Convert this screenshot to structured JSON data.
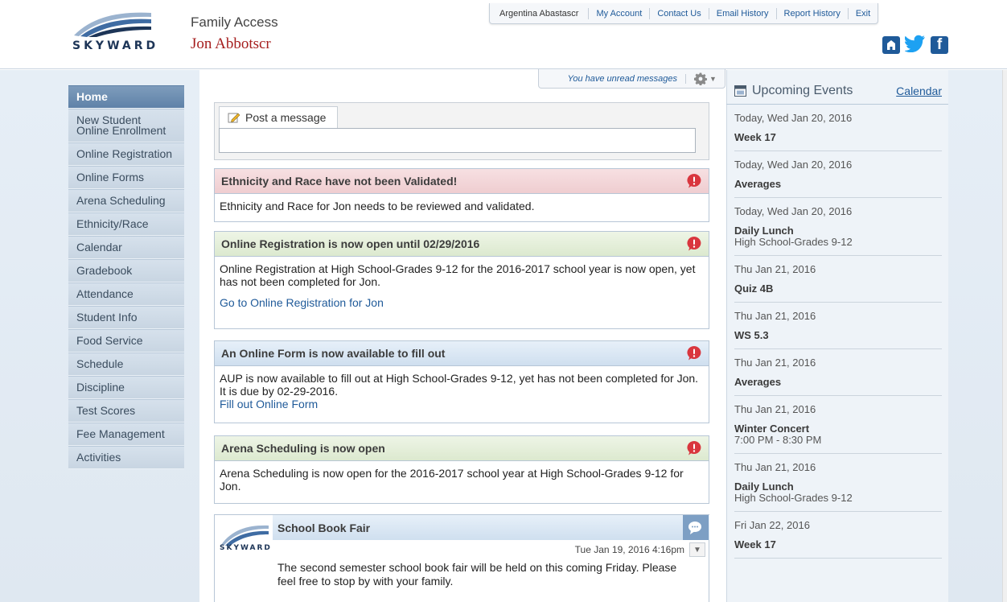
{
  "header": {
    "app_title": "Family Access",
    "student_name": "Jon Abbotscr",
    "logo_text": "SKYWARD",
    "user_name": "Argentina Abastascr",
    "links": [
      "My Account",
      "Contact Us",
      "Email History",
      "Report History",
      "Exit"
    ]
  },
  "nav": {
    "items": [
      "Home",
      "New Student Online Enrollment",
      "Online Registration",
      "Online Forms",
      "Arena Scheduling",
      "Ethnicity/Race",
      "Calendar",
      "Gradebook",
      "Attendance",
      "Student Info",
      "Food Service",
      "Schedule",
      "Discipline",
      "Test Scores",
      "Fee Management",
      "Activities"
    ],
    "active": "Home"
  },
  "message_bar": {
    "unread_text": "You have unread messages"
  },
  "post": {
    "tab_label": "Post a message",
    "input_value": ""
  },
  "alerts": [
    {
      "title": "Ethnicity and Race have not been Validated!",
      "text": "Ethnicity and Race for Jon needs to be reviewed and validated.",
      "link": ""
    },
    {
      "title": "Online Registration is now open until 02/29/2016",
      "text": "Online Registration at High School-Grades 9-12 for the 2016-2017 school year is now open, yet has not been completed for Jon.",
      "link": "Go to Online Registration for Jon"
    },
    {
      "title": "An Online Form is now available to fill out",
      "text": "AUP is now available to fill out at High School-Grades 9-12, yet has not been completed for Jon.  It is due by 02-29-2016.",
      "link": "Fill out Online Form"
    },
    {
      "title": "Arena Scheduling is now open",
      "text": "Arena Scheduling is now open for the 2016-2017 school year at High School-Grades 9-12 for Jon.",
      "link": ""
    }
  ],
  "book_fair": {
    "title": "School Book Fair",
    "logo_text": "SKYWARD",
    "timestamp": "Tue Jan 19, 2016 4:16pm",
    "text": "The second semester school book fair will be held on this coming Friday. Please feel free to stop by with your family."
  },
  "events": {
    "title": "Upcoming Events",
    "calendar_link": "Calendar",
    "items": [
      {
        "date": "Today, Wed Jan 20, 2016",
        "name": "Week 17",
        "sub": ""
      },
      {
        "date": "Today, Wed Jan 20, 2016",
        "name": "Averages",
        "sub": ""
      },
      {
        "date": "Today, Wed Jan 20, 2016",
        "name": "Daily Lunch",
        "sub": "High School-Grades 9-12"
      },
      {
        "date": "Thu Jan 21, 2016",
        "name": "Quiz 4B",
        "sub": ""
      },
      {
        "date": "Thu Jan 21, 2016",
        "name": "WS 5.3",
        "sub": ""
      },
      {
        "date": "Thu Jan 21, 2016",
        "name": "Averages",
        "sub": ""
      },
      {
        "date": "Thu Jan 21, 2016",
        "name": "Winter Concert",
        "sub": "7:00 PM - 8:30 PM"
      },
      {
        "date": "Thu Jan 21, 2016",
        "name": "Daily Lunch",
        "sub": "High School-Grades 9-12"
      },
      {
        "date": "Fri Jan 22, 2016",
        "name": "Week 17",
        "sub": ""
      }
    ]
  },
  "colors": {
    "accent": "#1f5a99",
    "nav_active": "#6a8cb2",
    "student_name": "#a51d1d",
    "alert_red": "#d9363e"
  },
  "icons": {
    "social": [
      "school-icon",
      "twitter-icon",
      "facebook-icon"
    ],
    "alert": "exclamation-icon",
    "settings": "gear-icon"
  }
}
